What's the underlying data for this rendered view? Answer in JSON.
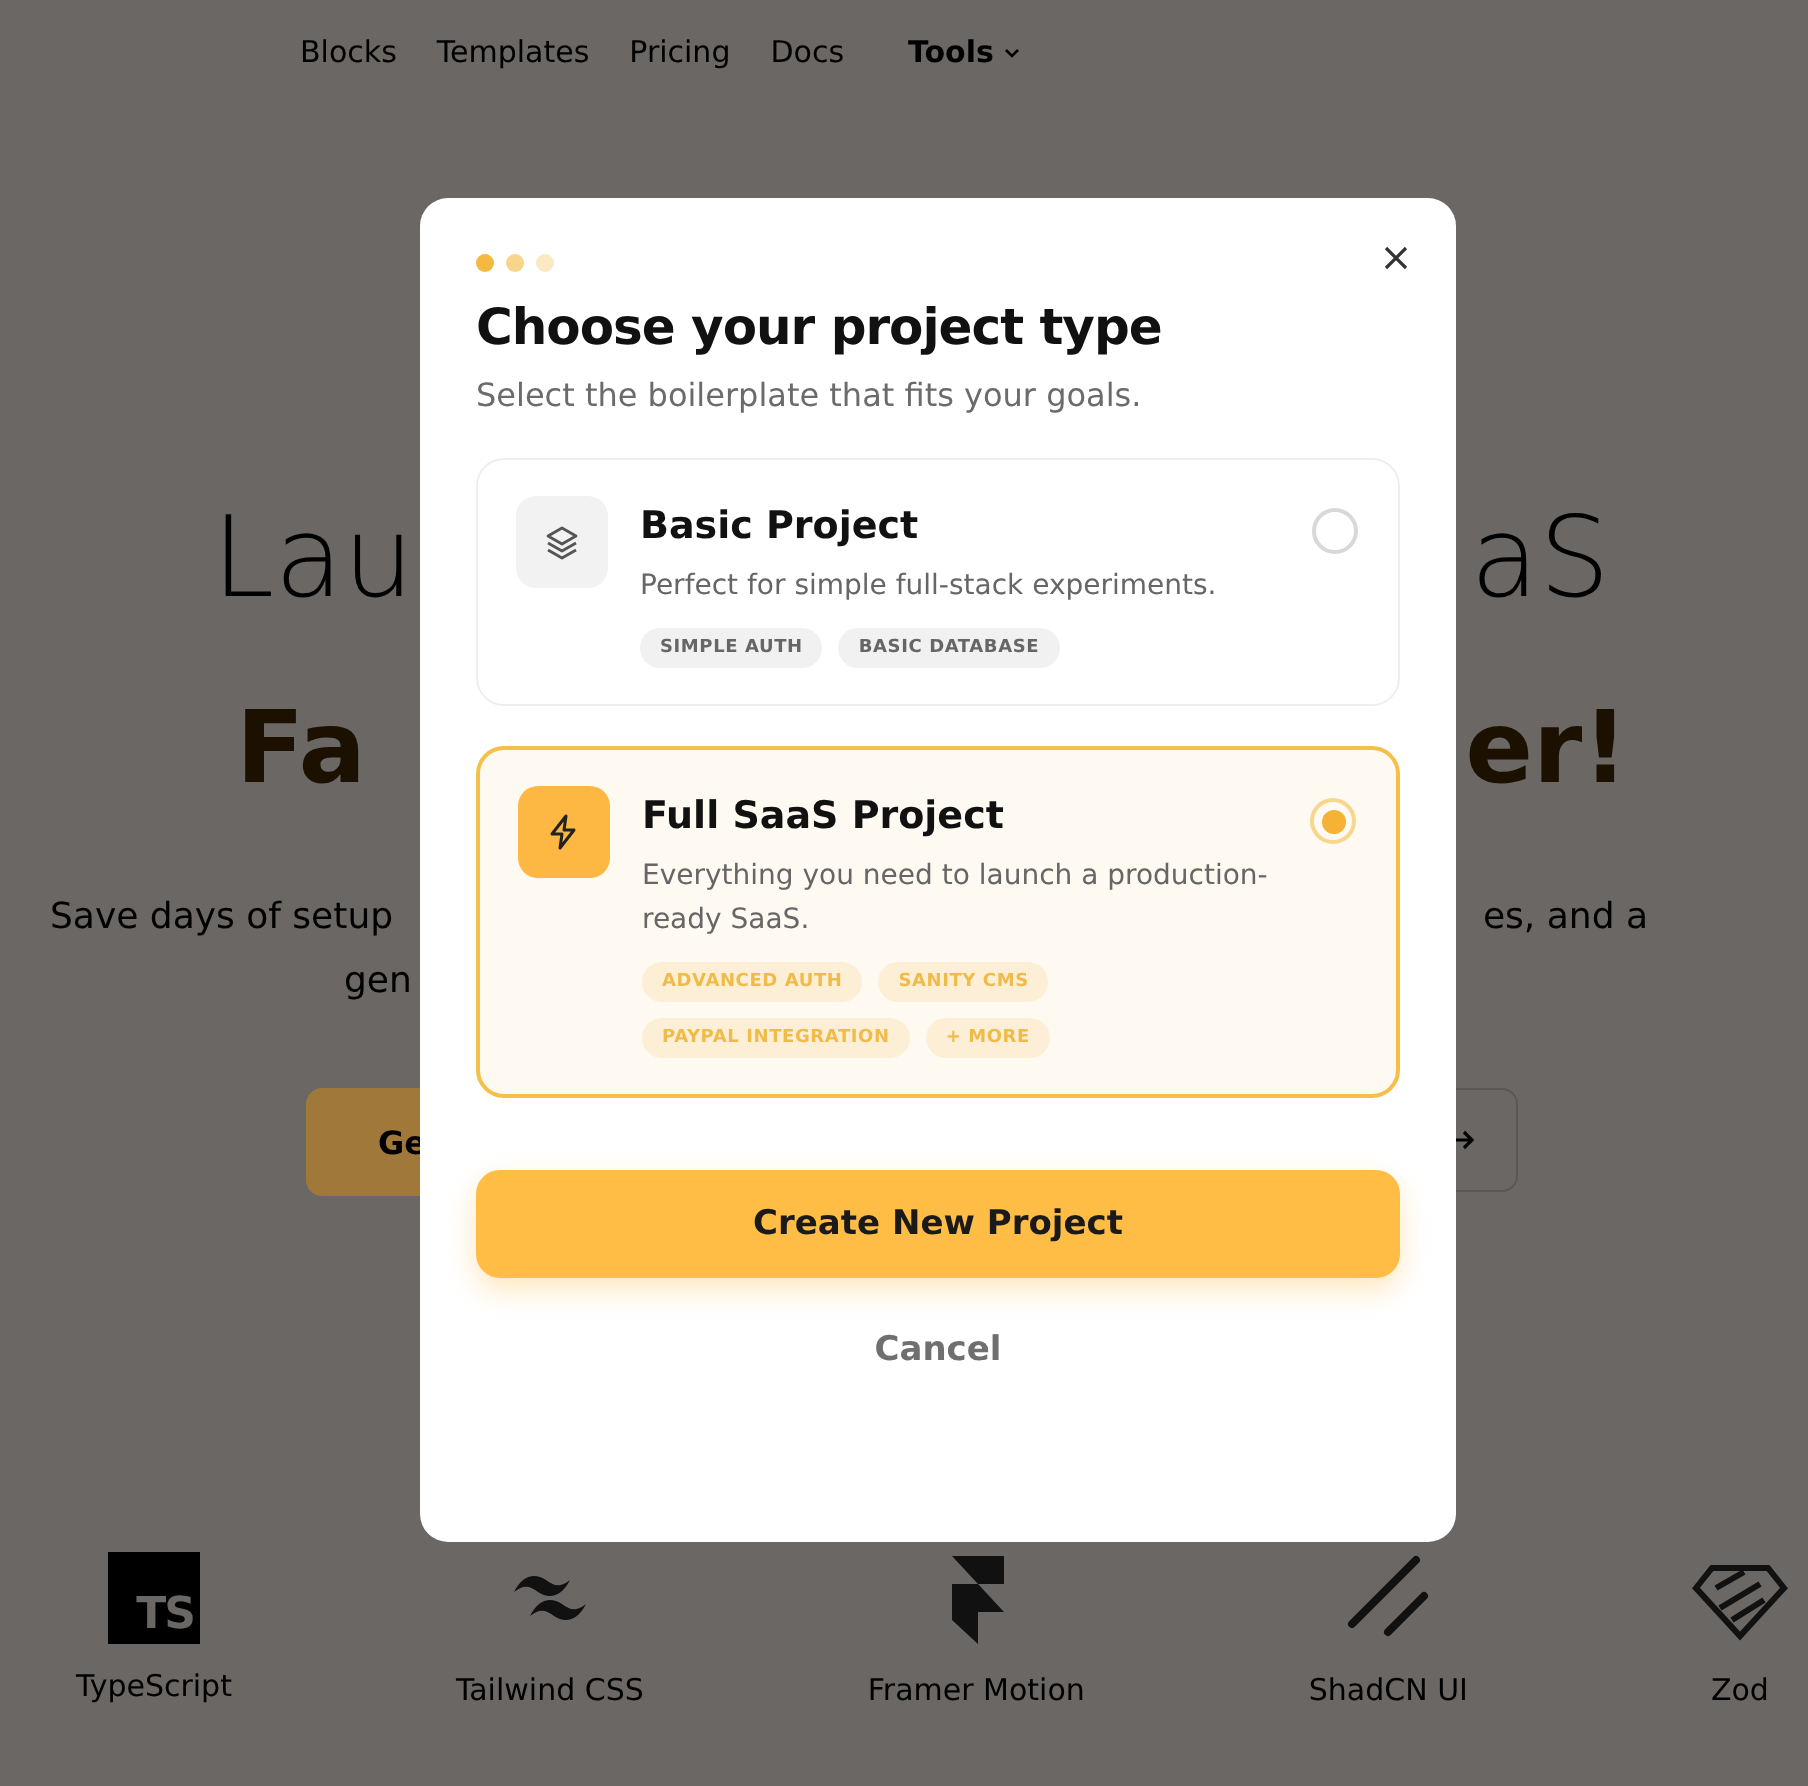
{
  "nav": {
    "items": [
      {
        "label": "Blocks",
        "kind": "link"
      },
      {
        "label": "Templates",
        "kind": "link"
      },
      {
        "label": "Pricing",
        "kind": "link"
      },
      {
        "label": "Docs",
        "kind": "link"
      },
      {
        "label": "Tools",
        "kind": "dropdown"
      }
    ]
  },
  "hero": {
    "heading_lines": [
      {
        "left": "Lau",
        "right": "aS",
        "kind": "plain"
      },
      {
        "left": "Fa",
        "right": "er!",
        "kind": "accent"
      }
    ],
    "subtitle_lines": [
      {
        "left": "Save days of setup",
        "right": "es, and a"
      },
      {
        "left": "gen"
      }
    ],
    "primary_button": {
      "label": "Ge"
    },
    "secondary_button": {
      "kind": "arrow"
    }
  },
  "tech_stack": [
    {
      "name": "TypeScript",
      "kind": "ts",
      "logo_text": "TS"
    },
    {
      "name": "Tailwind CSS",
      "kind": "tailwind"
    },
    {
      "name": "Framer Motion",
      "kind": "framer"
    },
    {
      "name": "ShadCN UI",
      "kind": "shadcn"
    },
    {
      "name": "Zod",
      "kind": "zod"
    }
  ],
  "modal": {
    "step_dots": [
      {
        "color": "#f5b942"
      },
      {
        "color": "#f8d48c"
      },
      {
        "color": "#fbe8c4"
      }
    ],
    "title": "Choose your project type",
    "subtitle": "Select the boilerplate that fits your goals.",
    "options": [
      {
        "title": "Basic Project",
        "description": "Perfect for simple full-stack experiments.",
        "tags": [
          "SIMPLE AUTH",
          "BASIC DATABASE"
        ],
        "kind": "basic",
        "selected": false
      },
      {
        "title": "Full SaaS Project",
        "description": "Everything you need to launch a production-ready SaaS.",
        "tags": [
          "ADVANCED AUTH",
          "SANITY CMS",
          "PAYPAL INTEGRATION",
          "+ MORE"
        ],
        "kind": "full",
        "selected": true
      }
    ],
    "primary_button": "Create New Project",
    "cancel_button": "Cancel"
  }
}
